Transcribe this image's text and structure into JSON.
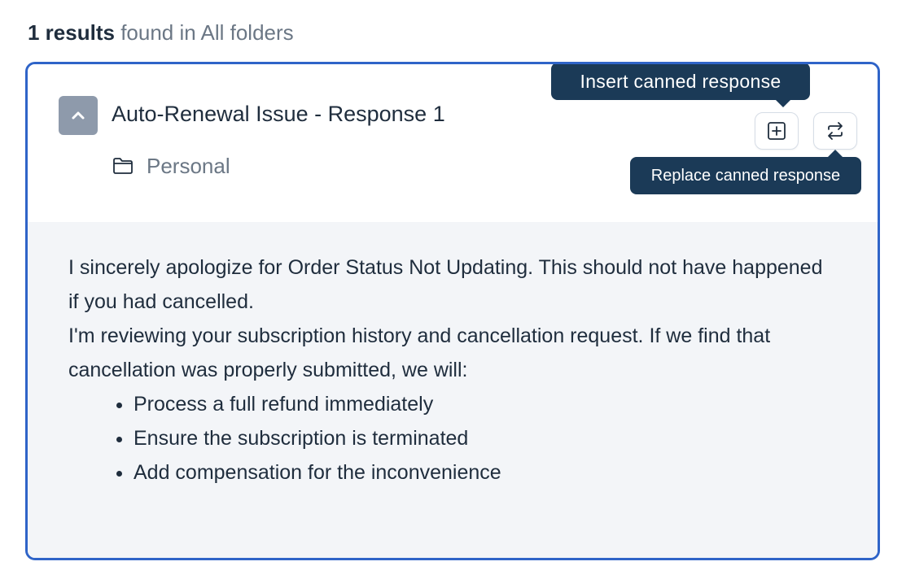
{
  "summary": {
    "count_label": "1 results",
    "scope_label": "found in All folders"
  },
  "card": {
    "title": "Auto-Renewal Issue - Response 1",
    "folder": "Personal",
    "actions": {
      "insert_tooltip": "Insert canned response",
      "replace_tooltip": "Replace canned response"
    },
    "body": {
      "line1": "I sincerely apologize for Order Status Not Updating. This should not have happened if you had cancelled.",
      "line2": "I'm reviewing your subscription history and cancellation request. If we find that cancellation was properly submitted, we will:",
      "bullets": [
        "Process a full refund immediately",
        "Ensure the subscription is terminated",
        "Add compensation for the inconvenience"
      ]
    }
  },
  "icons": {
    "collapse": "chevron-up-icon",
    "folder": "folder-icon",
    "insert": "plus-square-icon",
    "replace": "swap-arrows-icon"
  },
  "colors": {
    "accent_border": "#2f64c8",
    "tooltip_bg": "#1b3a57",
    "collapse_bg": "#8e9aab",
    "body_bg": "#f3f5f8"
  }
}
